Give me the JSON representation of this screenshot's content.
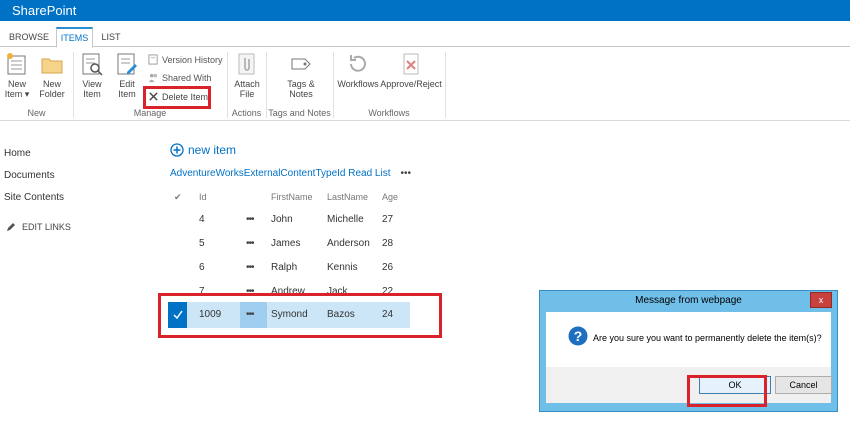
{
  "suitebar": {
    "brand": "SharePoint"
  },
  "tabs": [
    {
      "label": "BROWSE"
    },
    {
      "label": "ITEMS"
    },
    {
      "label": "LIST"
    }
  ],
  "ribbon": {
    "new_item": {
      "line1": "New",
      "line2": "Item"
    },
    "new_folder": {
      "line1": "New",
      "line2": "Folder"
    },
    "view_item": {
      "line1": "View",
      "line2": "Item"
    },
    "edit_item": {
      "line1": "Edit",
      "line2": "Item"
    },
    "version_history": "Version History",
    "shared_with": "Shared With",
    "delete_item": "Delete Item",
    "attach_file": {
      "line1": "Attach",
      "line2": "File"
    },
    "tags_notes": {
      "line1": "Tags &",
      "line2": "Notes"
    },
    "workflows": "Workflows",
    "approve_reject": "Approve/Reject",
    "groups": {
      "new": "New",
      "manage": "Manage",
      "actions": "Actions",
      "tags": "Tags and Notes",
      "workflows": "Workflows"
    }
  },
  "leftnav": {
    "items": [
      {
        "label": "Home"
      },
      {
        "label": "Documents"
      },
      {
        "label": "Site Contents"
      }
    ],
    "edit_links": "EDIT LINKS"
  },
  "list": {
    "new_item": "new item",
    "title": "AdventureWorksExternalContentTypeId Read List",
    "title_menu": "•••",
    "columns": {
      "check": "✔",
      "id": "Id",
      "first": "FirstName",
      "last": "LastName",
      "age": "Age"
    },
    "rows": [
      {
        "id": "4",
        "first": "John",
        "last": "Michelle",
        "age": "27"
      },
      {
        "id": "5",
        "first": "James",
        "last": "Anderson",
        "age": "28"
      },
      {
        "id": "6",
        "first": "Ralph",
        "last": "Kennis",
        "age": "26"
      },
      {
        "id": "7",
        "first": "Andrew",
        "last": "Jack",
        "age": "22"
      },
      {
        "id": "1009",
        "first": "Symond",
        "last": "Bazos",
        "age": "24"
      }
    ],
    "row_menu": "•••"
  },
  "dialog": {
    "title": "Message from webpage",
    "close": "x",
    "message": "Are you sure you want to permanently delete the item(s)?",
    "ok": "OK",
    "cancel": "Cancel"
  },
  "colors": {
    "suitebar": "#0072c6",
    "accent": "#0072c6",
    "highlight": "#d9222a",
    "selected_row": "#cde6f7"
  }
}
